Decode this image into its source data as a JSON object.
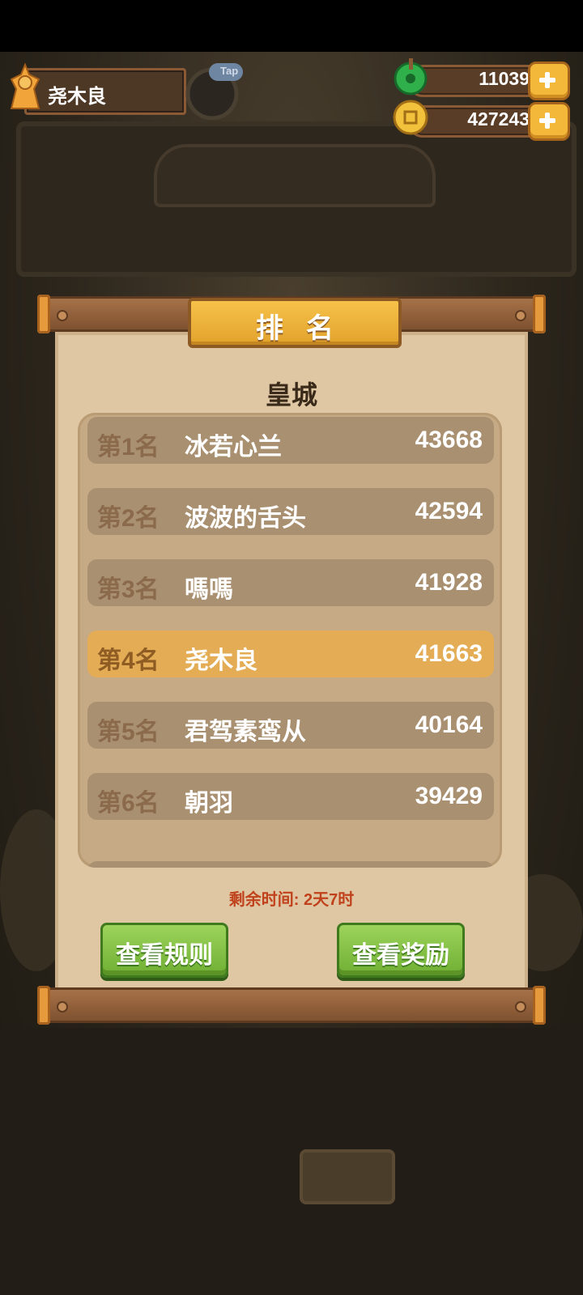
{
  "hud": {
    "player_name": "尧木良",
    "tap_label": "Tap",
    "jade_amount": "11039",
    "coin_amount": "427243"
  },
  "panel": {
    "title": "排名",
    "subtitle": "皇城",
    "rows": [
      {
        "rank": "第1名",
        "name": "冰若心兰",
        "score": "43668"
      },
      {
        "rank": "第2名",
        "name": "波波的舌头",
        "score": "42594"
      },
      {
        "rank": "第3名",
        "name": "嗎嗎",
        "score": "41928"
      },
      {
        "rank": "第4名",
        "name": "尧木良",
        "score": "41663"
      },
      {
        "rank": "第5名",
        "name": "君驾素鸾从",
        "score": "40164"
      },
      {
        "rank": "第6名",
        "name": "朝羽",
        "score": "39429"
      }
    ],
    "highlighted_rank": "第4名",
    "time_remaining": "剩余时间: 2天7时",
    "view_rules_label": "查看规则",
    "view_rewards_label": "查看奖励"
  },
  "colors": {
    "highlight_row": "#e3ac55",
    "normal_row": "#a99070",
    "button_green": "#7cba3e",
    "title_gold": "#f0b43a",
    "timer_red": "#c0421c"
  }
}
